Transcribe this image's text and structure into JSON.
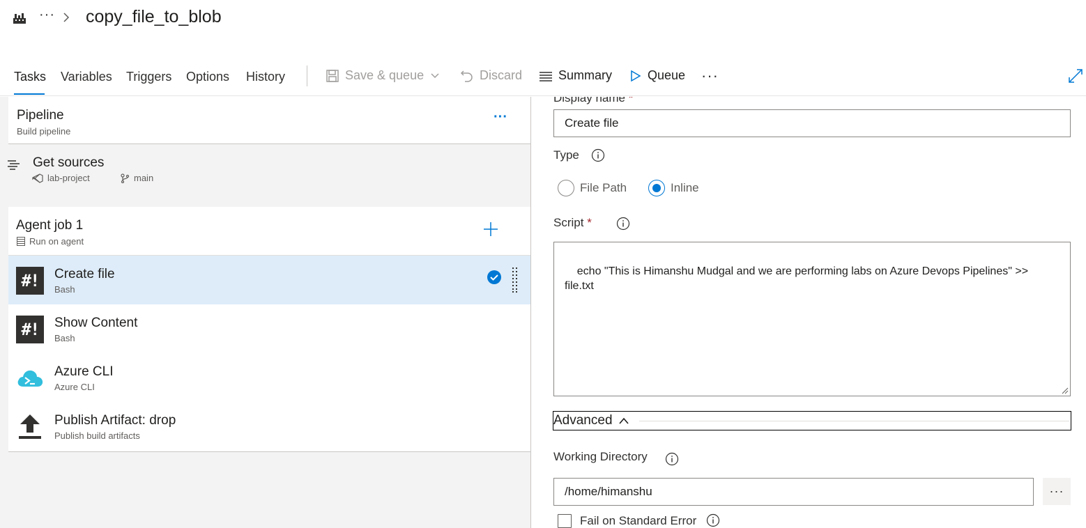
{
  "header": {
    "more": "···",
    "title": "copy_file_to_blob"
  },
  "toolbar": {
    "tabs": [
      {
        "label": "Tasks",
        "active": true
      },
      {
        "label": "Variables"
      },
      {
        "label": "Triggers"
      },
      {
        "label": "Options"
      },
      {
        "label": "History"
      }
    ],
    "save_queue_label": "Save & queue",
    "discard_label": "Discard",
    "summary_label": "Summary",
    "queue_label": "Queue",
    "more": "···"
  },
  "pipeline": {
    "title": "Pipeline",
    "subtitle": "Build pipeline",
    "more": "···"
  },
  "get_sources": {
    "title": "Get sources",
    "repo": "lab-project",
    "branch": "main"
  },
  "agent_job": {
    "title": "Agent job 1",
    "subtitle": "Run on agent"
  },
  "tasks": [
    {
      "title": "Create file",
      "subtitle": "Bash",
      "icon": "bash-icon",
      "selected": true
    },
    {
      "title": "Show Content",
      "subtitle": "Bash",
      "icon": "bash-icon"
    },
    {
      "title": "Azure CLI",
      "subtitle": "Azure CLI",
      "icon": "azure-cli-icon"
    },
    {
      "title": "Publish Artifact: drop",
      "subtitle": "Publish build artifacts",
      "icon": "upload-icon"
    }
  ],
  "form": {
    "display_name_label": "Display name",
    "display_name_value": "Create file",
    "type_label": "Type",
    "type_options": [
      "File Path",
      "Inline"
    ],
    "type_selected": "Inline",
    "script_label": "Script",
    "required_mark": "*",
    "script_value": "echo \"This is Himanshu Mudgal and we are performing labs on Azure Devops Pipelines\" >>\nfile.txt",
    "advanced_label": "Advanced",
    "working_dir_label": "Working Directory",
    "working_dir_value": "/home/himanshu",
    "browse_label": "···",
    "fail_on_stderr_label": "Fail on Standard Error",
    "fail_on_stderr_checked": false
  },
  "colors": {
    "accent": "#0078d4",
    "selected_row": "#deecf9",
    "panel_bg": "#f3f3f3"
  }
}
